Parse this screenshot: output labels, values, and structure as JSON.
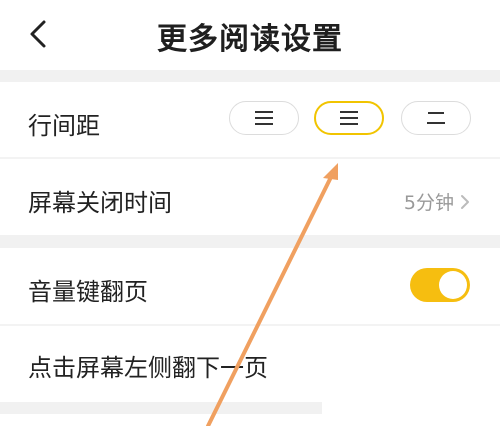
{
  "header": {
    "title": "更多阅读设置",
    "back_icon": "chevron-left-icon"
  },
  "settings": {
    "line_spacing": {
      "label": "行间距",
      "options": [
        {
          "icon": "three-lines-icon",
          "selected": false
        },
        {
          "icon": "three-lines-medium-icon",
          "selected": true
        },
        {
          "icon": "two-lines-icon",
          "selected": false
        }
      ]
    },
    "screen_off": {
      "label": "屏幕关闭时间",
      "value": "5分钟"
    },
    "volume_key": {
      "label": "音量键翻页",
      "enabled": true
    },
    "tap_left": {
      "label": "点击屏幕左侧翻下一页"
    }
  },
  "colors": {
    "accent": "#f6be10",
    "annotation_arrow": "#f0a060"
  }
}
